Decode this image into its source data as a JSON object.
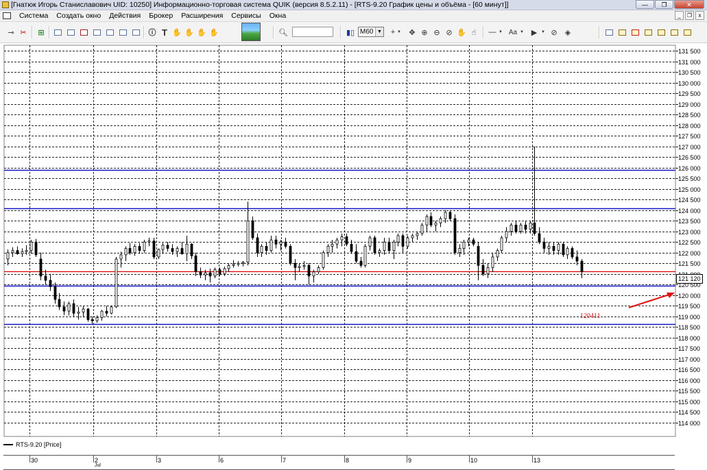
{
  "window": {
    "title": "[Гнатюк Игорь Станиславович UID: 10250] Информационно-торговая система QUIK (версия 8.5.2.11) - [RTS-9.20 График цены и объёма - [60 минут]]",
    "minimize": "—",
    "maximize": "❐",
    "close": "✕"
  },
  "menu": {
    "items": [
      "Система",
      "Создать окно",
      "Действия",
      "Брокер",
      "Расширения",
      "Сервисы",
      "Окна"
    ],
    "mdi_minimize": "_",
    "mdi_restore": "❐",
    "mdi_close": "x"
  },
  "toolbar": {
    "interval": "M60",
    "search_value": ""
  },
  "colors": {
    "level_blue": "#1414c8",
    "level_red": "#dc0000",
    "annotation_red": "#e01010",
    "candle": "#000000"
  },
  "chart_data": {
    "type": "candlestick",
    "instrument": "RTS-9.20",
    "legend": "RTS-9.20 [Price]",
    "price_scale": {
      "min": 114000,
      "max": 131500,
      "step": 500,
      "labels": [
        "131 500",
        "131 000",
        "130 500",
        "130 000",
        "129 500",
        "129 000",
        "128 500",
        "128 000",
        "127 500",
        "127 000",
        "126 500",
        "126 000",
        "125 500",
        "125 000",
        "124 500",
        "124 000",
        "123 500",
        "123 000",
        "122 500",
        "122 000",
        "121 500",
        "121 000",
        "120 500",
        "120 000",
        "119 500",
        "119 000",
        "118 500",
        "118 000",
        "117 500",
        "117 000",
        "116 500",
        "116 000",
        "115 500",
        "115 000",
        "114 500",
        "114 000"
      ]
    },
    "current_price_label": "121 120",
    "current_price": 121120,
    "horizontal_levels": [
      {
        "price": 125900,
        "color": "blue"
      },
      {
        "price": 124100,
        "color": "blue"
      },
      {
        "price": 121120,
        "color": "red"
      },
      {
        "price": 120450,
        "color": "blue"
      },
      {
        "price": 118650,
        "color": "blue"
      }
    ],
    "annotation": {
      "text": "120411"
    },
    "x_axis_labels": [
      "30",
      "2",
      "3",
      "6",
      "7",
      "8",
      "9",
      "10",
      "13"
    ],
    "x_axis_sublabel": "Jul",
    "candles": [
      [
        121700,
        122150,
        121400,
        122000
      ],
      [
        122000,
        122250,
        121800,
        122100
      ],
      [
        122100,
        122300,
        121900,
        121950
      ],
      [
        121950,
        122200,
        121800,
        122050
      ],
      [
        122050,
        122350,
        121900,
        122100
      ],
      [
        122100,
        122600,
        121950,
        122500
      ],
      [
        122500,
        122650,
        121800,
        121900
      ],
      [
        121700,
        122000,
        120700,
        120900
      ],
      [
        120900,
        121200,
        120500,
        120700
      ],
      [
        120700,
        121000,
        120200,
        120400
      ],
      [
        120400,
        120600,
        119600,
        119800
      ],
      [
        119800,
        120100,
        119300,
        119450
      ],
      [
        119450,
        119700,
        119050,
        119250
      ],
      [
        119250,
        119700,
        119050,
        119600
      ],
      [
        119600,
        119800,
        119000,
        119150
      ],
      [
        119150,
        119450,
        118850,
        119200
      ],
      [
        119200,
        119500,
        118950,
        119350
      ],
      [
        119350,
        119400,
        118750,
        118850
      ],
      [
        118850,
        119000,
        118650,
        118800
      ],
      [
        118800,
        119050,
        118700,
        118950
      ],
      [
        118950,
        119300,
        118800,
        119250
      ],
      [
        119250,
        119500,
        119000,
        119150
      ],
      [
        119150,
        119500,
        119100,
        119450
      ],
      [
        119450,
        121800,
        119400,
        121700
      ],
      [
        121700,
        122050,
        121300,
        121900
      ],
      [
        121900,
        122300,
        121600,
        122200
      ],
      [
        122200,
        122450,
        121900,
        122000
      ],
      [
        122000,
        122400,
        121850,
        122300
      ],
      [
        122300,
        122450,
        121950,
        122100
      ],
      [
        122100,
        122600,
        122000,
        122500
      ],
      [
        122500,
        122700,
        122300,
        122550
      ],
      [
        122550,
        122700,
        121700,
        121800
      ],
      [
        121800,
        122200,
        121700,
        122150
      ],
      [
        122150,
        122450,
        121950,
        122350
      ],
      [
        122350,
        122500,
        122050,
        122200
      ],
      [
        122200,
        122400,
        121900,
        122050
      ],
      [
        122050,
        122300,
        121800,
        122200
      ],
      [
        122200,
        122500,
        121900,
        121950
      ],
      [
        121950,
        122800,
        121600,
        122400
      ],
      [
        122400,
        122450,
        121700,
        121850
      ],
      [
        121850,
        122000,
        120900,
        121100
      ],
      [
        121100,
        121300,
        120800,
        120950
      ],
      [
        120950,
        121200,
        120700,
        121050
      ],
      [
        121050,
        121250,
        120600,
        120900
      ],
      [
        120900,
        121300,
        120800,
        121200
      ],
      [
        121200,
        121300,
        120900,
        121000
      ],
      [
        121000,
        121350,
        120900,
        121250
      ],
      [
        121250,
        121500,
        121100,
        121400
      ],
      [
        121400,
        121650,
        121300,
        121450
      ],
      [
        121450,
        121600,
        121350,
        121500
      ],
      [
        121500,
        121600,
        121350,
        121550
      ],
      [
        121550,
        124400,
        121400,
        123500
      ],
      [
        123500,
        123700,
        122600,
        122700
      ],
      [
        122700,
        122900,
        121800,
        122000
      ],
      [
        122000,
        122400,
        121800,
        122300
      ],
      [
        122300,
        122500,
        121900,
        122100
      ],
      [
        122100,
        122800,
        122000,
        122600
      ],
      [
        122600,
        122800,
        122200,
        122400
      ],
      [
        122400,
        122600,
        122100,
        122500
      ],
      [
        122500,
        122700,
        122200,
        122300
      ],
      [
        122300,
        122400,
        121400,
        121500
      ],
      [
        121500,
        121700,
        120700,
        121300
      ],
      [
        121300,
        121500,
        121100,
        121350
      ],
      [
        121350,
        121600,
        121200,
        121400
      ],
      [
        121400,
        121500,
        120500,
        120900
      ],
      [
        120900,
        121200,
        120600,
        121100
      ],
      [
        121100,
        121400,
        121000,
        121300
      ],
      [
        121300,
        122100,
        121200,
        122000
      ],
      [
        122000,
        122400,
        121800,
        122300
      ],
      [
        122300,
        122600,
        122000,
        122400
      ],
      [
        122400,
        122700,
        122200,
        122600
      ],
      [
        122600,
        122900,
        122300,
        122750
      ],
      [
        122750,
        122900,
        122300,
        122400
      ],
      [
        122400,
        122600,
        121950,
        122050
      ],
      [
        122050,
        122400,
        121500,
        121600
      ],
      [
        121600,
        121800,
        121300,
        121400
      ],
      [
        121400,
        122400,
        121300,
        122300
      ],
      [
        122300,
        122800,
        122100,
        122700
      ],
      [
        122700,
        122800,
        121900,
        122000
      ],
      [
        122000,
        122200,
        121800,
        122100
      ],
      [
        122100,
        122700,
        121900,
        122500
      ],
      [
        122500,
        122700,
        122000,
        122100
      ],
      [
        122100,
        122600,
        121700,
        122500
      ],
      [
        122500,
        122900,
        122300,
        122800
      ],
      [
        122800,
        122900,
        122000,
        122300
      ],
      [
        122300,
        122800,
        122200,
        122700
      ],
      [
        122700,
        122900,
        122500,
        122800
      ],
      [
        122800,
        123000,
        122600,
        122900
      ],
      [
        122900,
        123400,
        122800,
        123300
      ],
      [
        123300,
        123800,
        123000,
        123700
      ],
      [
        123700,
        123900,
        123200,
        123300
      ],
      [
        123300,
        123500,
        123000,
        123400
      ],
      [
        123400,
        123700,
        123200,
        123600
      ],
      [
        123600,
        124000,
        123400,
        123900
      ],
      [
        123900,
        124000,
        123500,
        123600
      ],
      [
        123600,
        123800,
        121900,
        122000
      ],
      [
        122000,
        122400,
        121800,
        122200
      ],
      [
        122200,
        122600,
        121900,
        122500
      ],
      [
        122500,
        122700,
        122300,
        122600
      ],
      [
        122600,
        122700,
        122300,
        122400
      ],
      [
        122300,
        122500,
        120700,
        121400
      ],
      [
        121400,
        121700,
        120900,
        121000
      ],
      [
        121000,
        121500,
        120800,
        121300
      ],
      [
        121300,
        122000,
        121100,
        121800
      ],
      [
        121800,
        122200,
        121600,
        122100
      ],
      [
        122100,
        122800,
        122000,
        122700
      ],
      [
        122700,
        123200,
        122500,
        123000
      ],
      [
        123000,
        123400,
        122800,
        123300
      ],
      [
        123300,
        123500,
        122900,
        123000
      ],
      [
        123000,
        123400,
        122900,
        123300
      ],
      [
        123300,
        123500,
        122900,
        123100
      ],
      [
        123100,
        123500,
        122900,
        123400
      ],
      [
        123400,
        127000,
        122800,
        122900
      ],
      [
        122900,
        123200,
        122400,
        122500
      ],
      [
        122500,
        122700,
        122000,
        122200
      ],
      [
        122200,
        122500,
        121900,
        122300
      ],
      [
        122300,
        122500,
        121900,
        122100
      ],
      [
        122100,
        122500,
        121900,
        122400
      ],
      [
        122400,
        122500,
        121800,
        121900
      ],
      [
        121900,
        122300,
        121700,
        122200
      ],
      [
        122200,
        122300,
        121700,
        121800
      ],
      [
        121800,
        122100,
        121400,
        121600
      ],
      [
        121600,
        121700,
        120800,
        121100
      ]
    ]
  }
}
